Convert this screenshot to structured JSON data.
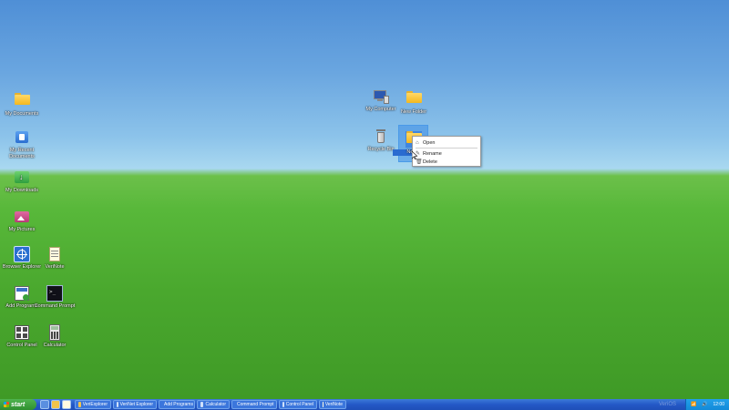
{
  "desktop": {
    "icons_left": [
      {
        "label": "My Documents",
        "icon": "folder-icon"
      },
      {
        "label": "My Recent Documents",
        "icon": "recent-documents-icon"
      },
      {
        "label": "My Downloads",
        "icon": "downloads-icon"
      },
      {
        "label": "My Pictures",
        "icon": "pictures-icon"
      },
      {
        "label": "Browser Explorer",
        "icon": "browser-icon"
      },
      {
        "label": "VeriNote",
        "icon": "notepad-icon"
      },
      {
        "label": "Add Programs",
        "icon": "add-programs-icon"
      },
      {
        "label": "Command Prompt",
        "icon": "command-prompt-icon"
      },
      {
        "label": "Control Panel",
        "icon": "control-panel-icon"
      },
      {
        "label": "Calculator",
        "icon": "calculator-icon"
      }
    ],
    "icons_right": [
      {
        "label": "My Computer",
        "icon": "computer-icon"
      },
      {
        "label": "New Folder",
        "icon": "folder-icon"
      },
      {
        "label": "Recycle Bin",
        "icon": "recycle-bin-icon"
      },
      {
        "label": "New...",
        "icon": "folder-icon",
        "selected": true
      }
    ]
  },
  "context_menu": {
    "items": [
      {
        "label": "Open",
        "icon": "open-icon"
      },
      {
        "label": "Rename",
        "icon": "rename-icon"
      },
      {
        "label": "Delete",
        "icon": "delete-icon"
      }
    ]
  },
  "taskbar": {
    "start_label": "start",
    "tasks": [
      {
        "label": "VeriExplorer"
      },
      {
        "label": "VeriNet Explorer"
      },
      {
        "label": "Add Programs"
      },
      {
        "label": "Calculator"
      },
      {
        "label": "Command Prompt"
      },
      {
        "label": "Control Panel"
      },
      {
        "label": "VeriNote"
      }
    ],
    "watermark": "VeriOS",
    "clock": "12:00"
  },
  "colors": {
    "sky": "#4f8fd6",
    "grass": "#4aa82e",
    "taskbar": "#2458c6",
    "start": "#3a9c3a"
  }
}
